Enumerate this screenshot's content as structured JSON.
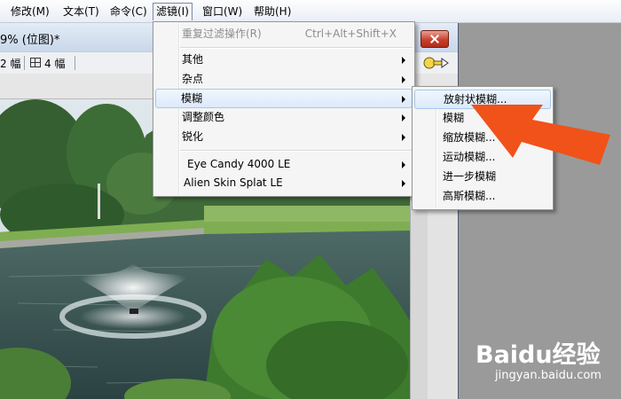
{
  "menubar": {
    "items": [
      {
        "label": "修改(M)"
      },
      {
        "label": "文本(T)"
      },
      {
        "label": "命令(C)"
      },
      {
        "label": "滤镜(I)"
      },
      {
        "label": "窗口(W)"
      },
      {
        "label": "帮助(H)"
      }
    ]
  },
  "document": {
    "title": "9% (位图)*",
    "toolbar": {
      "left_count": "2 幅",
      "grid_count": "4 幅"
    }
  },
  "filter_menu": {
    "items": [
      {
        "label": "重复过滤操作(R)",
        "shortcut": "Ctrl+Alt+Shift+X",
        "disabled": true
      },
      {
        "label": "其他"
      },
      {
        "label": "杂点"
      },
      {
        "label": "模糊"
      },
      {
        "label": "调整颜色"
      },
      {
        "label": "锐化"
      },
      {
        "label": "Eye Candy 4000 LE"
      },
      {
        "label": "Alien Skin Splat LE"
      }
    ]
  },
  "blur_submenu": {
    "items": [
      {
        "label": "放射状模糊..."
      },
      {
        "label": "模糊"
      },
      {
        "label": "缩放模糊..."
      },
      {
        "label": "运动模糊..."
      },
      {
        "label": "进一步模糊"
      },
      {
        "label": "高斯模糊..."
      }
    ]
  },
  "watermark": {
    "logo": "Baidu经验",
    "url": "jingyan.baidu.com"
  },
  "colors": {
    "annotation_arrow": "#f0521a",
    "menu_highlight": "#dceafb"
  }
}
